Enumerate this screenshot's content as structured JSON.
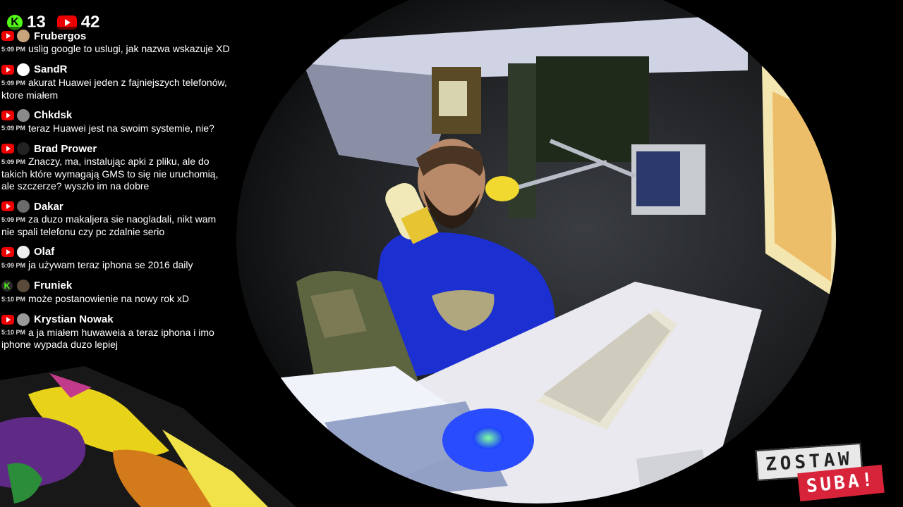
{
  "counters": {
    "kick_count": "13",
    "youtube_count": "42"
  },
  "chat": [
    {
      "platform": "youtube",
      "user": "Frubergos",
      "time": "5:09 PM",
      "text": "uslig google to uslugi, jak nazwa wskazuje XD"
    },
    {
      "platform": "youtube",
      "user": "SandR",
      "time": "5:09 PM",
      "text": "akurat Huawei jeden z fajniejszych telefonów, ktore miałem"
    },
    {
      "platform": "youtube",
      "user": "Chkdsk",
      "time": "5:09 PM",
      "text": "teraz Huawei jest na swoim systemie, nie?"
    },
    {
      "platform": "youtube",
      "user": "Brad Prower",
      "time": "5:09 PM",
      "text": "Znaczy, ma, instalując apki z pliku, ale do takich które wymagają GMS to się nie uruchomią, ale szczerze? wyszło im na dobre"
    },
    {
      "platform": "youtube",
      "user": "Dakar",
      "time": "5:09 PM",
      "text": "za duzo makaljera sie naogladali, nikt wam nie spali telefonu czy pc zdalnie serio"
    },
    {
      "platform": "youtube",
      "user": "Olaf",
      "time": "5:09 PM",
      "text": "ja używam teraz iphona se 2016 daily"
    },
    {
      "platform": "kick",
      "user": "Fruniek",
      "time": "5:10 PM",
      "text": "może postanowienie na nowy rok xD"
    },
    {
      "platform": "youtube",
      "user": "Krystian Nowak",
      "time": "5:10 PM",
      "text": "a ja miałem huwaweia a teraz iphona i imo iphone wypada duzo lepiej"
    }
  ],
  "subscribe": {
    "line1": "ZOSTAW",
    "line2": "SUBA!"
  },
  "colors": {
    "youtube": "#e00000",
    "kick": "#53fc18"
  }
}
